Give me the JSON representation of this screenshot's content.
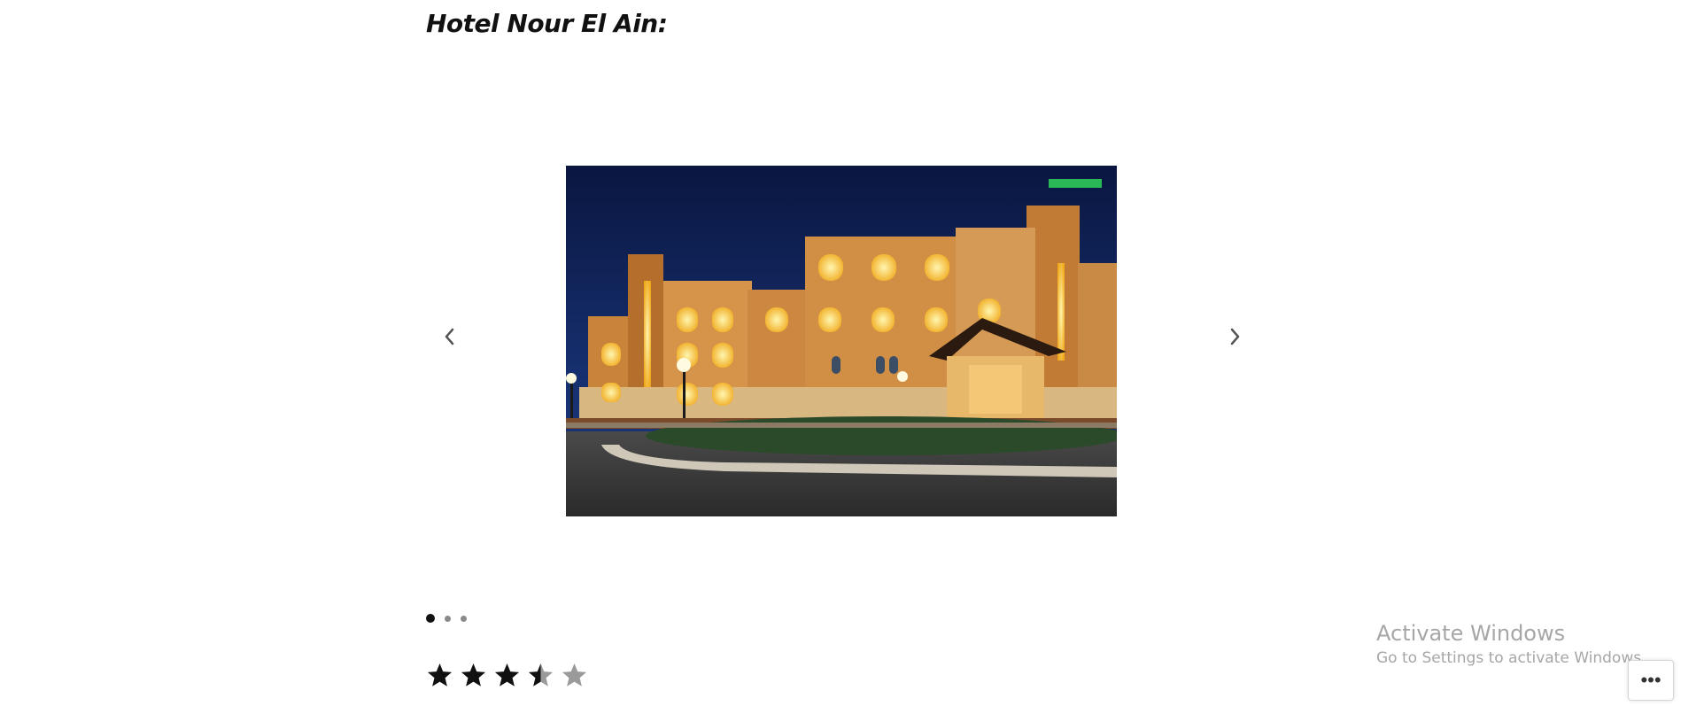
{
  "page": {
    "title": "Hotel Nour El Ain:"
  },
  "slider": {
    "image_alt": "Hotel Nour El Ain at night",
    "prev_icon": "chevron-left-icon",
    "next_icon": "chevron-right-icon",
    "slide_count": 3,
    "active_slide": 1
  },
  "rating": {
    "value": 3.5,
    "max": 5,
    "icon": "star-icon"
  },
  "windows_watermark": {
    "title": "Activate Windows",
    "subtitle": "Go to Settings to activate Windows."
  },
  "more_button": {
    "icon": "more-horizontal-icon",
    "label": "•••"
  },
  "colors": {
    "title_text": "#111111",
    "dot_active": "#111111",
    "dot_inactive": "#8a8a8a",
    "star_filled": "#111111",
    "star_empty": "#9a9a9a",
    "watermark_text": "#a6a6a6"
  }
}
